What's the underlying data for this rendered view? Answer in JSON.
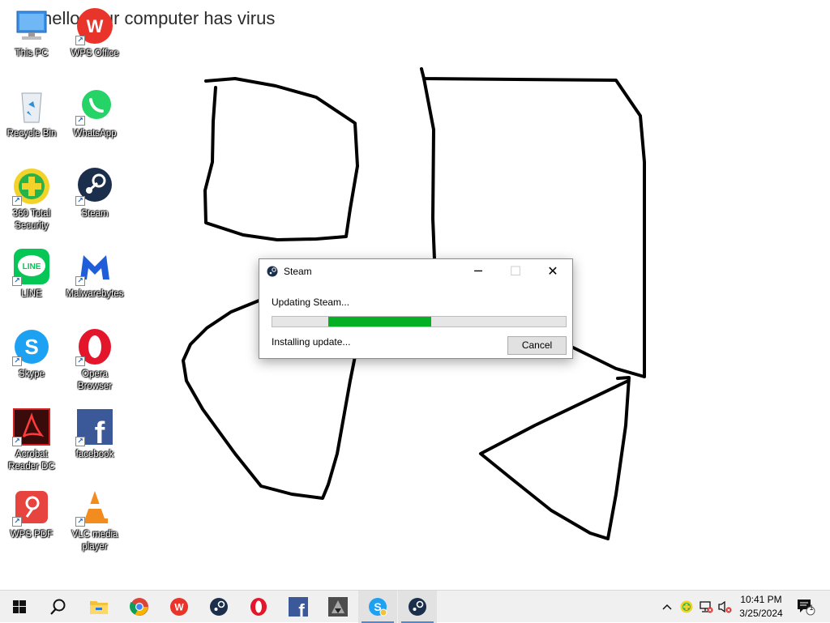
{
  "desktop": {
    "text": "hello your computer has virus",
    "icons": [
      {
        "label": "This PC",
        "icon": "this-pc-icon"
      },
      {
        "label": "WPS Office",
        "icon": "wps-office-icon"
      },
      {
        "label": "Recycle Bin",
        "icon": "recycle-bin-icon"
      },
      {
        "label": "WhatsApp",
        "icon": "whatsapp-icon"
      },
      {
        "label": "360 Total Security",
        "icon": "360-security-icon"
      },
      {
        "label": "Steam",
        "icon": "steam-icon"
      },
      {
        "label": "LINE",
        "icon": "line-icon"
      },
      {
        "label": "Malwarebytes",
        "icon": "malwarebytes-icon"
      },
      {
        "label": "Skype",
        "icon": "skype-icon"
      },
      {
        "label": "Opera Browser",
        "icon": "opera-icon"
      },
      {
        "label": "Acrobat Reader DC",
        "icon": "acrobat-icon"
      },
      {
        "label": "facebook",
        "icon": "facebook-icon"
      },
      {
        "label": "WPS PDF",
        "icon": "wps-pdf-icon"
      },
      {
        "label": "VLC media player",
        "icon": "vlc-icon"
      }
    ]
  },
  "dialog": {
    "title": "Steam",
    "minimize_glyph": "─",
    "maximize_glyph": "☐",
    "close_glyph": "✕",
    "status": "Updating Steam...",
    "progress": 0.54,
    "progress_segment_start": 0.19,
    "substatus": "Installing update...",
    "cancel_label": "Cancel"
  },
  "taskbar": {
    "apps": [
      "start-icon",
      "search-icon",
      "file-explorer-icon",
      "chrome-icon",
      "wps-office-icon",
      "steam-icon",
      "opera-icon",
      "facebook-icon",
      "game-icon",
      "skype-icon",
      "steam-icon"
    ],
    "clock_time": "10:41 PM",
    "clock_date": "3/25/2024",
    "notification_count": "1"
  },
  "colors": {
    "progress_green": "#06b025",
    "taskbar_bg": "#f0f0f0",
    "accent": "#4a8ad8"
  }
}
